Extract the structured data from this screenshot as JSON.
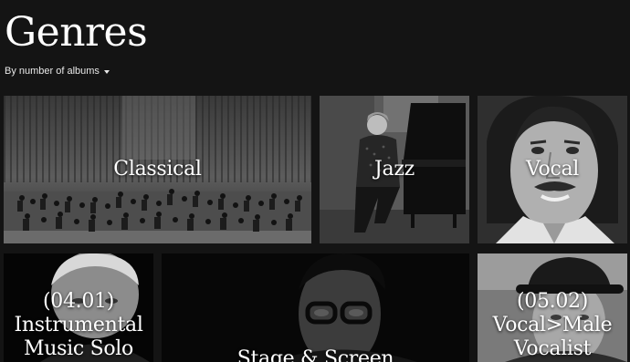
{
  "header": {
    "title": "Genres",
    "sort_label": "By number of albums"
  },
  "genres": [
    {
      "name": "Classical"
    },
    {
      "name": "Jazz"
    },
    {
      "name": "Vocal"
    },
    {
      "name_line1": "(04.01)",
      "name_line2": "Instrumental",
      "name_line3": "Music Solo"
    },
    {
      "name": "Stage & Screen"
    },
    {
      "name_line1": "(05.02)",
      "name_line2": "Vocal>Male",
      "name_line3": "Vocalist"
    }
  ],
  "colors": {
    "background": "#141414",
    "text": "#ffffff"
  },
  "icons": {
    "sort_caret": "caret-down-icon"
  }
}
